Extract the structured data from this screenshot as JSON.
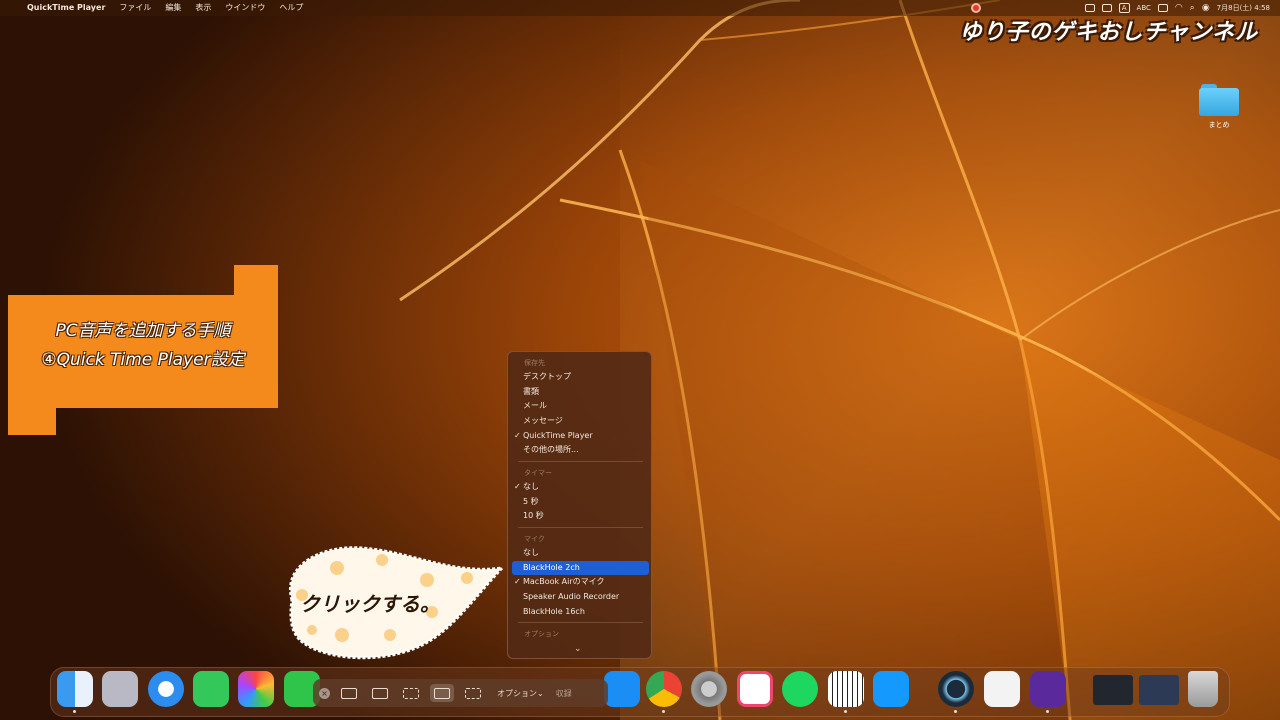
{
  "menubar": {
    "app": "QuickTime Player",
    "items": [
      "ファイル",
      "編集",
      "表示",
      "ウインドウ",
      "ヘルプ"
    ],
    "input_indicator": "A",
    "abc": "ABC",
    "clock": "7月8日(土) 4:58"
  },
  "channel_title": "ゆり子のゲキおしチャンネル",
  "desktop": {
    "folder_label": "まとめ"
  },
  "step_box": {
    "line1": "PC音声を追加する手順",
    "line2": "④Quick Time Player設定"
  },
  "bubble": {
    "text": "クリックする。"
  },
  "menu": {
    "save_header": "保存先",
    "save_items": [
      {
        "label": "デスクトップ",
        "checked": false
      },
      {
        "label": "書類",
        "checked": false
      },
      {
        "label": "メール",
        "checked": false
      },
      {
        "label": "メッセージ",
        "checked": false
      },
      {
        "label": "QuickTime Player",
        "checked": true
      },
      {
        "label": "その他の場所...",
        "checked": false
      }
    ],
    "timer_header": "タイマー",
    "timer_items": [
      {
        "label": "なし",
        "checked": true
      },
      {
        "label": "5 秒",
        "checked": false
      },
      {
        "label": "10 秒",
        "checked": false
      }
    ],
    "mic_header": "マイク",
    "mic_items": [
      {
        "label": "なし",
        "checked": false
      },
      {
        "label": "BlackHole 2ch",
        "checked": false,
        "highlighted": true
      },
      {
        "label": "MacBook Airのマイク",
        "checked": true
      },
      {
        "label": "Speaker Audio Recorder",
        "checked": false
      },
      {
        "label": "BlackHole 16ch",
        "checked": false
      }
    ],
    "options_header": "オプション",
    "checkmark": "✓",
    "more_icon": "chevron-down-icon"
  },
  "capture_toolbar": {
    "options_label": "オプション⌄",
    "record_label": "収録"
  },
  "colors": {
    "accent_orange": "#f58a1c",
    "highlight_blue": "#1f5fd4",
    "record_red": "#e23a1e"
  },
  "dock_apps": [
    "finder-icon",
    "launchpad-icon",
    "safari-icon",
    "messages-icon",
    "photos-icon",
    "facetime-icon",
    "app-store-icon",
    "chrome-icon",
    "system-settings-icon",
    "screen-recorder-icon",
    "spotify-icon",
    "piano-icon",
    "prime-video-icon",
    "quicktime-icon",
    "textedit-icon",
    "video-app-icon",
    "trash-icon"
  ]
}
